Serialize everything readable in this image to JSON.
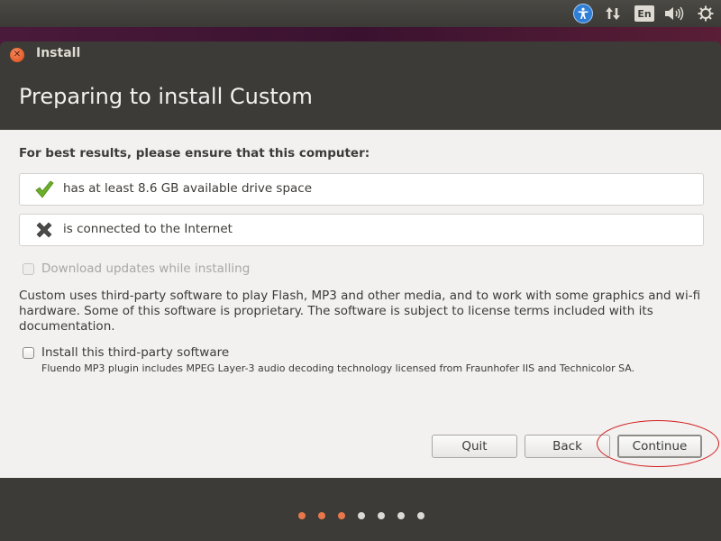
{
  "panel": {
    "language": "En",
    "icons": [
      "accessibility-icon",
      "network-arrows-icon",
      "keyboard-language-icon",
      "volume-icon",
      "gear-icon"
    ]
  },
  "window": {
    "title": "Install",
    "heading": "Preparing to install Custom"
  },
  "requirements": {
    "heading": "For best results, please ensure that this computer:",
    "items": [
      {
        "text": "has at least 8.6 GB available drive space",
        "status": "met"
      },
      {
        "text": "is connected to the Internet",
        "status": "not-met"
      }
    ]
  },
  "options": {
    "download_updates": {
      "label": "Download updates while installing",
      "checked": false,
      "enabled": false
    },
    "third_party": {
      "label": "Install this third-party software",
      "checked": false,
      "enabled": true
    }
  },
  "third_party_info": "Custom uses third-party software to play Flash, MP3 and other media, and to work with some graphics and wi-fi hardware. Some of this software is proprietary. The software is subject to license terms included with its documentation.",
  "third_party_note": "Fluendo MP3 plugin includes MPEG Layer-3 audio decoding technology licensed from Fraunhofer IIS and Technicolor SA.",
  "buttons": {
    "quit": "Quit",
    "back": "Back",
    "continue": "Continue"
  },
  "progress": {
    "current_step": 3,
    "total_steps": 7
  },
  "colors": {
    "accent": "#e8784b",
    "annotation": "#d11a1a",
    "check": "#6cae2a"
  }
}
